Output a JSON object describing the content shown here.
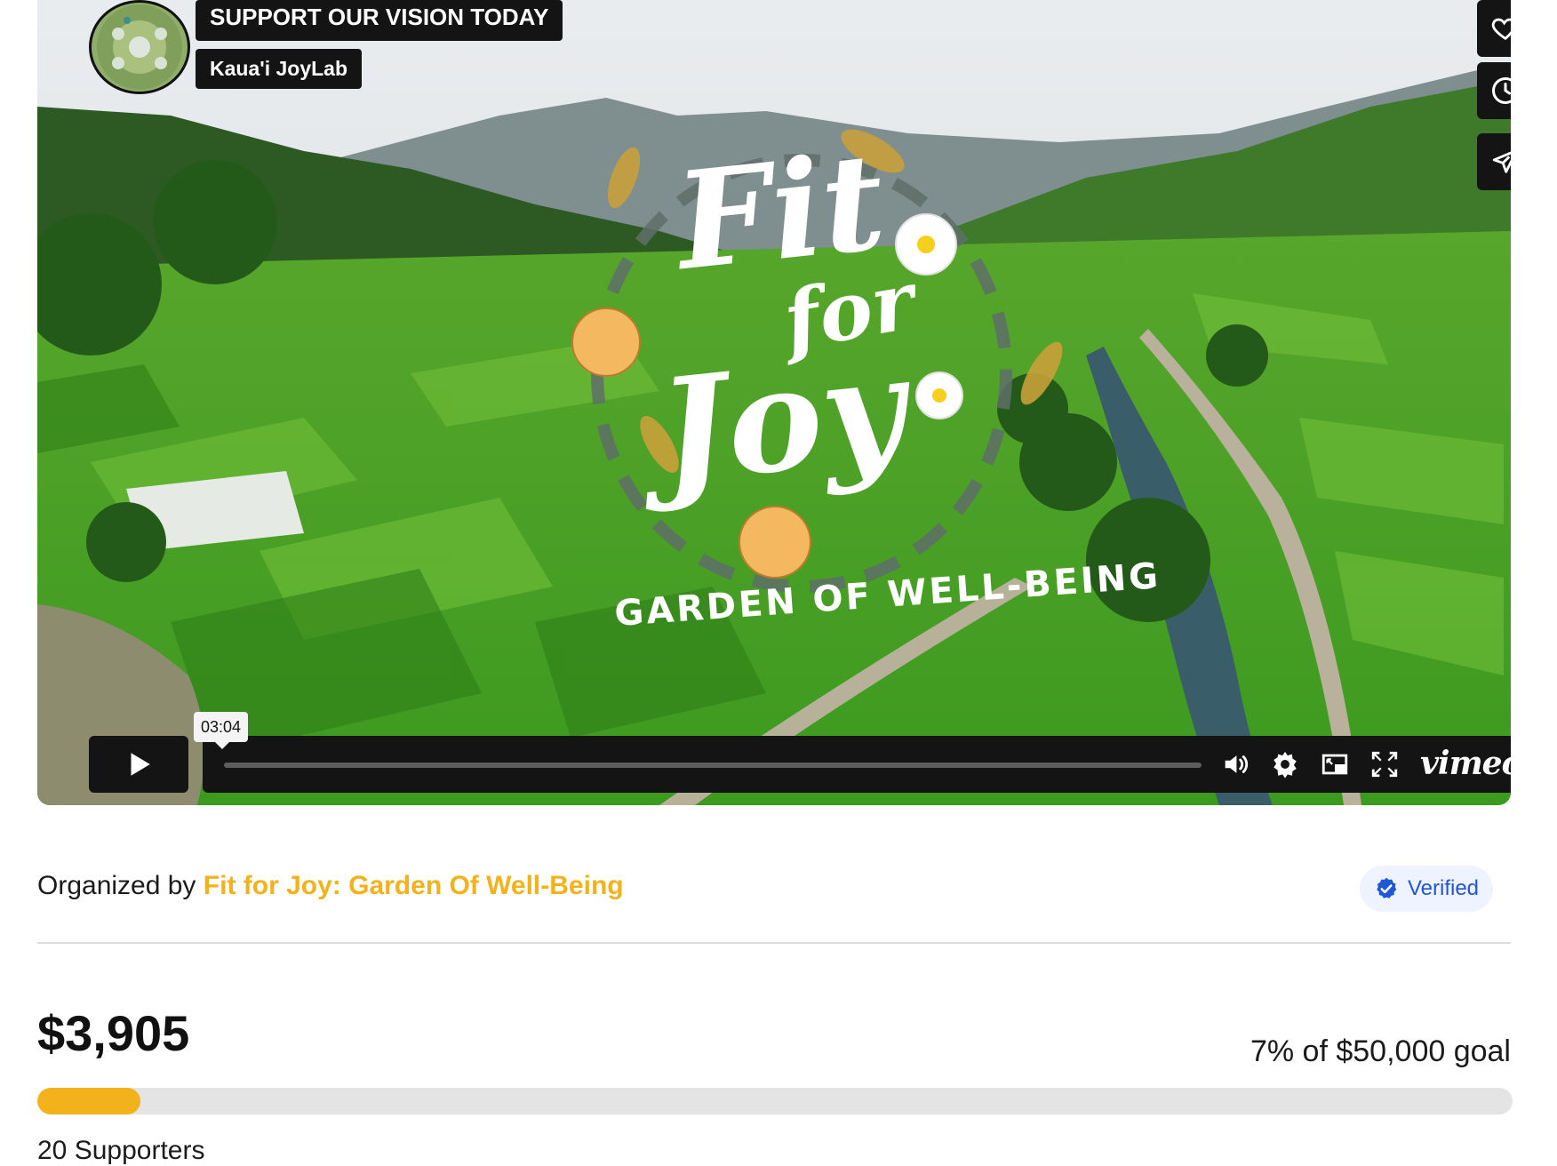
{
  "video": {
    "title_tag": "SUPPORT OUR VISION TODAY",
    "owner_tag": "Kaua'i JoyLab",
    "overlay_title_line1": "Fit",
    "overlay_title_line2": "for",
    "overlay_title_line3": "Joy",
    "overlay_subtitle": "GARDEN OF WELL-BEING",
    "time_tooltip": "03:04",
    "player_brand": "vimeo",
    "side_actions": [
      "heart-icon",
      "clock-icon",
      "send-icon"
    ],
    "controls": [
      "volume-icon",
      "settings-icon",
      "pip-icon",
      "fullscreen-icon"
    ]
  },
  "organizer": {
    "prefix": "Organized by",
    "name": "Fit for Joy: Garden Of Well-Being",
    "verified_label": "Verified"
  },
  "fundraiser": {
    "raised": "$3,905",
    "goal_text": "7% of $50,000 goal",
    "progress_fraction": 0.07,
    "supporters": "20 Supporters"
  },
  "colors": {
    "accent": "#f3b21c",
    "verified_blue": "#1f57d6",
    "player_dark": "#141414"
  }
}
